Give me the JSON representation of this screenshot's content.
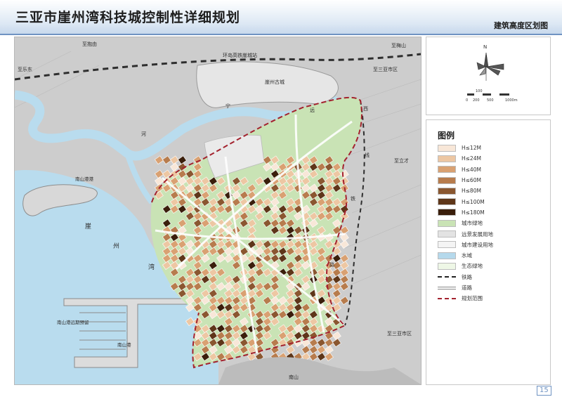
{
  "header": {
    "title": "三亚市崖州湾科技城控制性详细规划",
    "subtitle": "建筑高度区划图"
  },
  "map": {
    "labels": {
      "road_north": "至抱由",
      "road_northeast": "至梅山",
      "road_west": "至乐东",
      "road_east_top": "至三亚市区",
      "road_east_mid": "至立才",
      "road_east_bottom": "至三亚市区",
      "station": "环岛高铁崖城站",
      "old_town": "崖州古城",
      "bay_char_1": "崖",
      "bay_char_2": "州",
      "bay_char_3": "湾",
      "river_1": "宁",
      "river_2": "远",
      "river_3": "河",
      "port": "南山港远期预留",
      "port_2": "南山港",
      "lake": "南山港港",
      "south": "南山",
      "rail_1": "西",
      "rail_2": "线",
      "rail_3": "铁",
      "road_s": "路"
    }
  },
  "compass": {
    "north_label": "N",
    "scale_labels": [
      "0",
      "200",
      "500",
      "1000m"
    ],
    "scale_top": "100"
  },
  "legend": {
    "title": "图例",
    "items": [
      {
        "label": "H≤12M",
        "color": "#f8e7d8",
        "kind": "fill"
      },
      {
        "label": "H≤24M",
        "color": "#edc7a3",
        "kind": "fill"
      },
      {
        "label": "H≤40M",
        "color": "#d9a172",
        "kind": "fill"
      },
      {
        "label": "H≤60M",
        "color": "#b77c4d",
        "kind": "fill"
      },
      {
        "label": "H≤80M",
        "color": "#8a5730",
        "kind": "fill"
      },
      {
        "label": "H≤100M",
        "color": "#5e3619",
        "kind": "fill"
      },
      {
        "label": "H≤180M",
        "color": "#3a1e0b",
        "kind": "fill"
      },
      {
        "label": "城市绿地",
        "color": "#c9e3b5",
        "kind": "fill"
      },
      {
        "label": "远景发展用地",
        "color": "#e3e3e3",
        "kind": "fill"
      },
      {
        "label": "城市建设用地",
        "color": "#f4f4f4",
        "kind": "fill"
      },
      {
        "label": "水域",
        "color": "#b5d9ec",
        "kind": "fill"
      },
      {
        "label": "生态绿地",
        "color": "#eef7e6",
        "kind": "fill"
      },
      {
        "label": "铁路",
        "color": "#222222",
        "kind": "rail"
      },
      {
        "label": "道路",
        "color": "#888888",
        "kind": "road"
      },
      {
        "label": "规划范围",
        "color": "#a3222e",
        "kind": "bound"
      }
    ]
  },
  "page_number": "15"
}
